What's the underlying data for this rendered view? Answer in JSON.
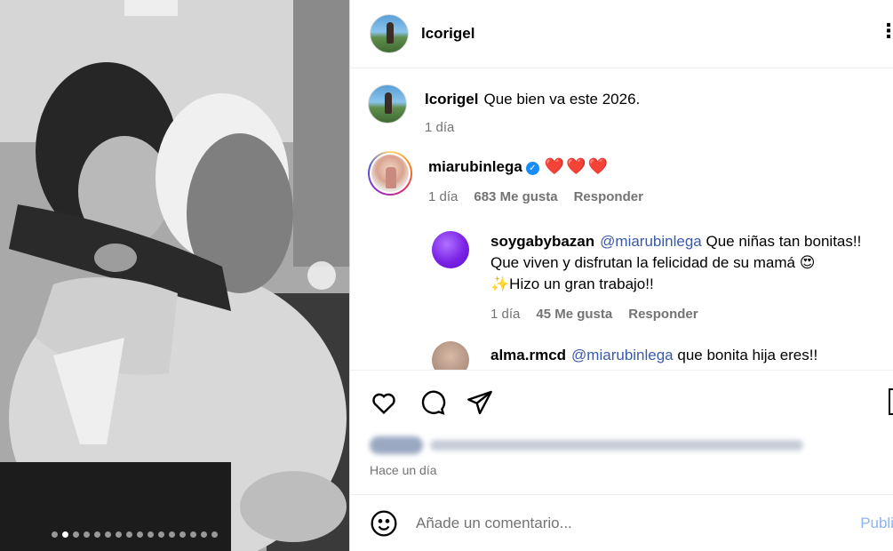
{
  "post": {
    "author": "lcorigel",
    "carousel": {
      "count": 16,
      "active_index": 1
    }
  },
  "caption": {
    "username": "lcorigel",
    "text": "Que bien va este 2026.",
    "time": "1 día"
  },
  "comments": [
    {
      "username": "miarubinlega",
      "verified": true,
      "text": "❤️❤️❤️",
      "time": "1 día",
      "likes": "683 Me gusta",
      "reply_label": "Responder"
    }
  ],
  "replies": [
    {
      "username": "soygabybazan",
      "mention": "@miarubinlega",
      "line1": "Que niñas tan bonitas!!",
      "line2": "Que viven y disfrutan la felicidad de su mamá 😍",
      "line3": "✨Hizo un gran trabajo!!",
      "time": "1 día",
      "likes": "45 Me gusta",
      "reply_label": "Responder"
    },
    {
      "username": "alma.rmcd",
      "mention": "@miarubinlega",
      "text": "que bonita hija eres!!"
    }
  ],
  "footer": {
    "time": "Hace un día",
    "comment_placeholder": "Añade un comentario...",
    "post_label": "Publi"
  },
  "icons": {
    "like": "heart-icon",
    "comment": "comment-icon",
    "share": "share-icon",
    "save": "bookmark-icon",
    "emoji": "emoji-icon",
    "more": "more-icon"
  },
  "colors": {
    "mention": "#3a5aa9",
    "verified": "#1a8cf5",
    "muted": "#737373",
    "post_button": "#8cb4f0"
  }
}
